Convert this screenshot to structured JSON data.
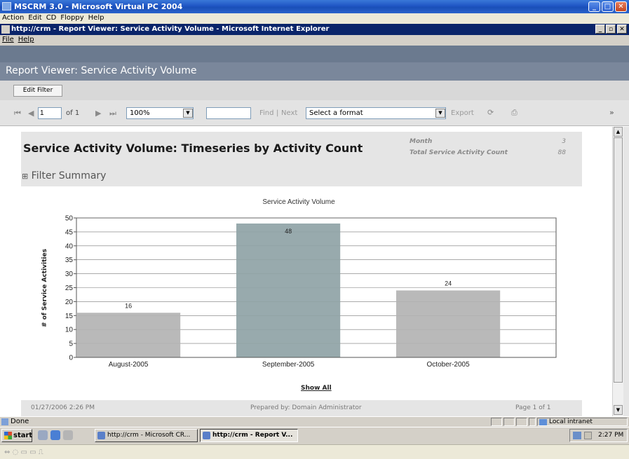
{
  "vpc_window": {
    "title": "MSCRM 3.0 - Microsoft Virtual PC 2004",
    "menu": [
      "Action",
      "Edit",
      "CD",
      "Floppy",
      "Help"
    ]
  },
  "browser": {
    "title": "http://crm - Report Viewer: Service Activity Volume - Microsoft Internet Explorer",
    "menu": [
      "File",
      "Help"
    ],
    "status_text": "Done",
    "zone": "Local intranet"
  },
  "report_viewer": {
    "title": "Report Viewer: Service Activity Volume",
    "edit_filter_label": "Edit Filter",
    "toolbar": {
      "page_value": "1",
      "page_of": "of 1",
      "zoom": "100%",
      "find_value": "",
      "find_label": "Find",
      "separator": "|",
      "next_label": "Next",
      "format_select": "Select a format",
      "export_label": "Export"
    }
  },
  "report": {
    "title": "Service Activity Volume: Timeseries by Activity Count",
    "filter_summary": "Filter Summary",
    "filter_toggle": "⊞",
    "meta": [
      {
        "label": "Month",
        "value": "3"
      },
      {
        "label": "Total Service Activity Count",
        "value": "88"
      }
    ],
    "show_all": "Show All",
    "footer": {
      "timestamp": "01/27/2006 2:26 PM",
      "prepared_by": "Prepared by: Domain Administrator",
      "page": "Page 1 of 1"
    }
  },
  "chart_data": {
    "type": "bar",
    "title": "Service Activity Volume",
    "xlabel": "",
    "ylabel": "# of Service Activities",
    "categories": [
      "August-2005",
      "September-2005",
      "October-2005"
    ],
    "values": [
      16,
      48,
      24
    ],
    "ylim": [
      0,
      50
    ],
    "yticks": [
      0,
      5,
      10,
      15,
      20,
      25,
      30,
      35,
      40,
      45,
      50
    ],
    "grid": true,
    "colors": {
      "bar": "#b3b3b3",
      "bar_highlight": "#8fa3a6"
    }
  },
  "taskbar": {
    "start_label": "start",
    "tasks": [
      {
        "label": "http://crm - Microsoft CR...",
        "active": false
      },
      {
        "label": "http://crm - Report V...",
        "active": true
      }
    ],
    "clock": "2:27 PM"
  }
}
